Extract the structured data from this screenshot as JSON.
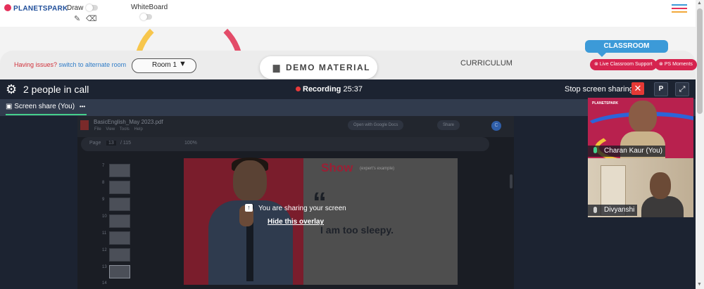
{
  "app": {
    "brand": "PLANETSPARK",
    "draw_label": "Draw",
    "whiteboard_label": "WhiteBoard"
  },
  "room_bar": {
    "issue_prefix": "Having issues?",
    "issue_link": "switch to alternate room",
    "room_select": "Room 1",
    "demo_material": "DEMO MATERIAL",
    "curriculum": "CURRICULUM",
    "classroom_tab": "CLASSROOM",
    "live_support": "Live Classroom Support",
    "ps_moments": "PS Moments"
  },
  "call": {
    "people_count": "2 people in call",
    "recording_label": "Recording",
    "recording_time": "25:37",
    "stop_share": "Stop screen sharing",
    "close_label": "✕",
    "p_label": "P",
    "expand_label": "⤢",
    "screen_share_tab": "Screen share (You)",
    "tab_menu": "•••"
  },
  "pdf_viewer": {
    "file_name": "BasicEnglish_May 2023.pdf",
    "menu": "File View Tools Help",
    "open_with": "Open with Google Docs",
    "share": "Share",
    "avatar_initial": "C",
    "page_label": "Page",
    "page_current": "13",
    "page_total": "/ 115",
    "zoom": "100%",
    "thumbnail_numbers": [
      "7",
      "8",
      "9",
      "10",
      "11",
      "12",
      "13",
      "14"
    ]
  },
  "slide": {
    "heading": "Show",
    "subheading": "(expert's example)",
    "quote_mark": "“",
    "quote_text": "I am too sleepy."
  },
  "overlay": {
    "message": "You are sharing your screen",
    "hide_link": "Hide this overlay"
  },
  "participants": [
    {
      "name": "Charan Kaur (You)",
      "mic": "on"
    },
    {
      "name": "Divyanshi",
      "mic": "muted"
    }
  ],
  "colors": {
    "call_bg": "#1c2331",
    "accent_red": "#e53935",
    "share_green": "#45d08c",
    "classroom_blue": "#3c9ad8",
    "support_pink": "#d6244f"
  }
}
